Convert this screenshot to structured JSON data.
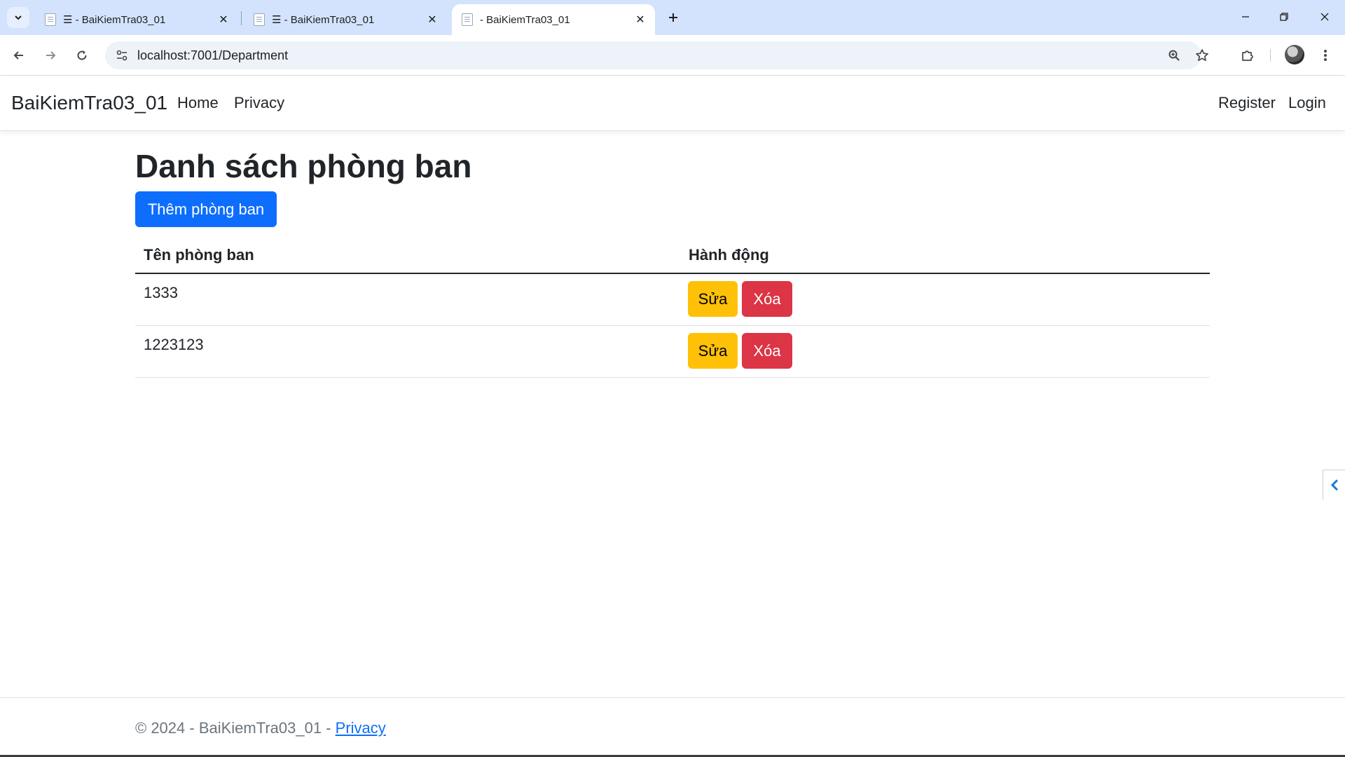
{
  "browser": {
    "tabs": [
      {
        "title": "☰ - BaiKiemTra03_01",
        "active": false
      },
      {
        "title": "☰ - BaiKiemTra03_01",
        "active": false
      },
      {
        "title": "- BaiKiemTra03_01",
        "active": true
      }
    ],
    "url": "localhost:7001/Department"
  },
  "nav": {
    "brand": "BaiKiemTra03_01",
    "links": [
      "Home",
      "Privacy"
    ],
    "right_links": [
      "Register",
      "Login"
    ]
  },
  "main": {
    "title": "Danh sách phòng ban",
    "add_button": "Thêm phòng ban",
    "table": {
      "headers": [
        "Tên phòng ban",
        "Hành động"
      ],
      "rows": [
        {
          "name": "1333",
          "edit": "Sửa",
          "delete": "Xóa"
        },
        {
          "name": "1223123",
          "edit": "Sửa",
          "delete": "Xóa"
        }
      ]
    }
  },
  "footer": {
    "text": "© 2024 - BaiKiemTra03_01 - ",
    "link": "Privacy"
  },
  "colors": {
    "primary": "#0d6efd",
    "warning": "#ffc107",
    "danger": "#dc3545",
    "tabstrip": "#d3e3fd"
  }
}
